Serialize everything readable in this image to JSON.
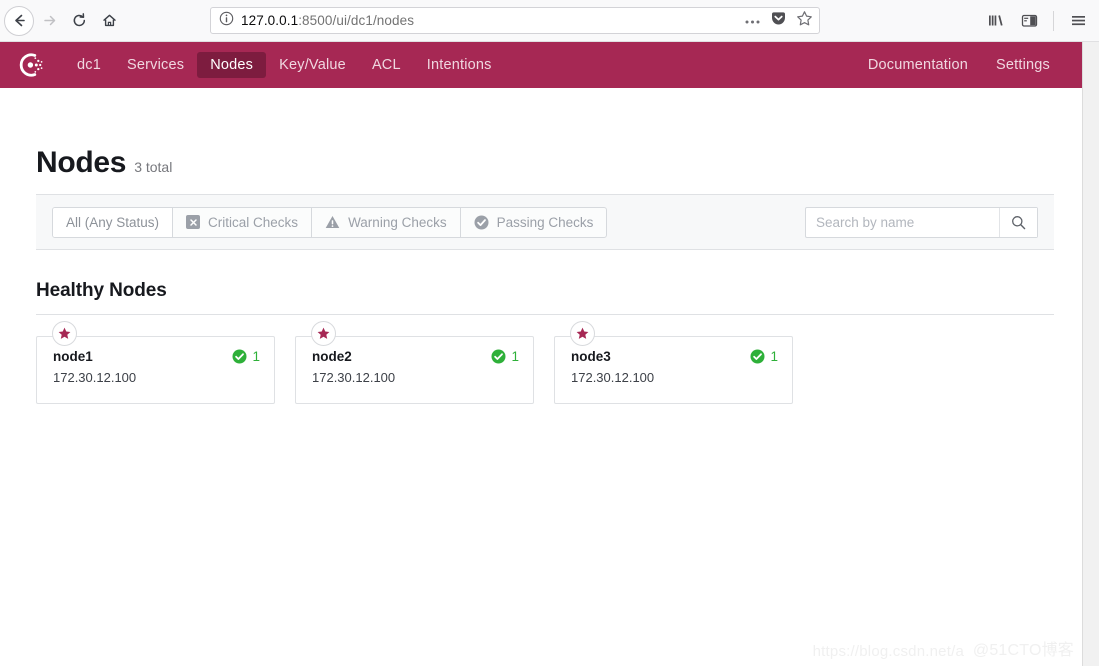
{
  "browser": {
    "back_label": "Back",
    "forward_label": "Forward",
    "reload_label": "Reload",
    "home_label": "Home",
    "url_host": "127.0.0.1",
    "url_rest": ":8500/ui/dc1/nodes",
    "page_actions_label": "Page actions",
    "pocket_label": "Save to Pocket",
    "bookmark_label": "Bookmark this page",
    "library_label": "Library",
    "sidebar_label": "Sidebars",
    "menu_label": "Open menu",
    "icons": {
      "site_info": "info-icon",
      "back": "arrow-left-icon",
      "forward": "arrow-right-icon",
      "reload": "reload-icon",
      "home": "home-icon",
      "page_actions": "ellipsis-icon",
      "pocket": "pocket-icon",
      "bookmark": "star-outline-icon",
      "library": "library-icon",
      "sidebar": "sidebar-icon",
      "menu": "hamburger-icon"
    }
  },
  "topnav": {
    "brand_icon": "consul-logo-icon",
    "links": [
      {
        "label": "dc1",
        "active": false
      },
      {
        "label": "Services",
        "active": false
      },
      {
        "label": "Nodes",
        "active": true
      },
      {
        "label": "Key/Value",
        "active": false
      },
      {
        "label": "ACL",
        "active": false
      },
      {
        "label": "Intentions",
        "active": false
      }
    ],
    "right_links": [
      {
        "label": "Documentation"
      },
      {
        "label": "Settings"
      }
    ],
    "bg_color": "#a62854",
    "active_bg_color": "#7d1c3f"
  },
  "header": {
    "title": "Nodes",
    "total": "3 total"
  },
  "filters": {
    "segments": [
      {
        "label": "All (Any Status)",
        "icon": "",
        "selected": true
      },
      {
        "label": "Critical Checks",
        "icon": "critical-icon",
        "selected": false
      },
      {
        "label": "Warning Checks",
        "icon": "warning-icon",
        "selected": false
      },
      {
        "label": "Passing Checks",
        "icon": "passing-icon",
        "selected": false
      }
    ],
    "search_placeholder": "Search by name",
    "search_value": "",
    "search_icon": "search-icon"
  },
  "section": {
    "heading": "Healthy Nodes"
  },
  "nodes": [
    {
      "name": "node1",
      "address": "172.30.12.100",
      "check_count": "1",
      "badge_icon": "star-icon",
      "status_icon": "check-circle-icon"
    },
    {
      "name": "node2",
      "address": "172.30.12.100",
      "check_count": "1",
      "badge_icon": "star-icon",
      "status_icon": "check-circle-icon"
    },
    {
      "name": "node3",
      "address": "172.30.12.100",
      "check_count": "1",
      "badge_icon": "star-icon",
      "status_icon": "check-circle-icon"
    }
  ],
  "colors": {
    "brand": "#a62854",
    "brand_dark": "#7d1c3f",
    "passing_green": "#2eb039",
    "star_magenta": "#a62854"
  },
  "watermarks": {
    "csdn": "https://blog.csdn.net/a",
    "cto": "@51CTO博客"
  }
}
